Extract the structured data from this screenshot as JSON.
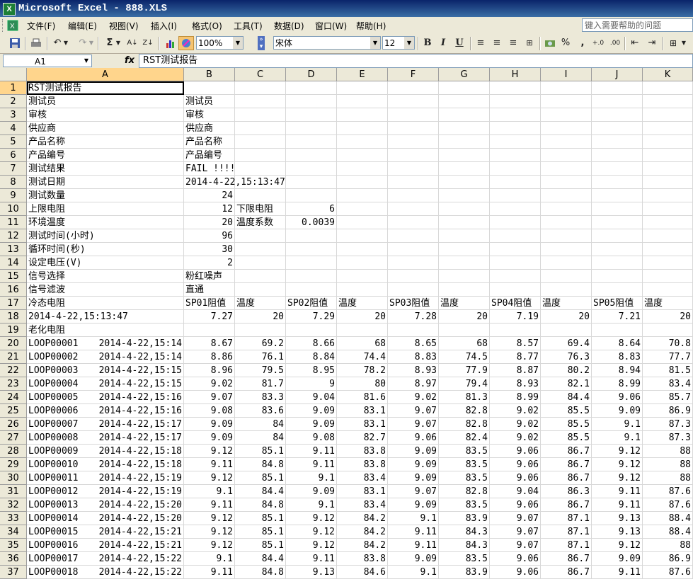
{
  "window": {
    "title": "Microsoft Excel - 888.XLS",
    "app_icon": "X"
  },
  "menu": [
    "文件(F)",
    "编辑(E)",
    "视图(V)",
    "插入(I)",
    "格式(O)",
    "工具(T)",
    "数据(D)",
    "窗口(W)",
    "帮助(H)"
  ],
  "help_placeholder": "键入需要帮助的问题",
  "toolbar": {
    "zoom": "100%",
    "font": "宋体",
    "font_size": "12",
    "bold": "B",
    "italic": "I",
    "underline": "U",
    "percent": "%",
    "comma": ","
  },
  "formula_bar": {
    "name_box": "A1",
    "fx_label": "fx",
    "content": "RST测试报告"
  },
  "column_labels": [
    "A",
    "B",
    "C",
    "D",
    "E",
    "F",
    "G",
    "H",
    "I",
    "J",
    "K"
  ],
  "row_numbers": [
    "1",
    "2",
    "3",
    "4",
    "5",
    "6",
    "7",
    "8",
    "9",
    "10",
    "11",
    "12",
    "13",
    "14",
    "15",
    "16",
    "17",
    "18",
    "19",
    "20",
    "21",
    "22",
    "23",
    "24",
    "25",
    "26",
    "27",
    "28",
    "29",
    "30",
    "31",
    "32",
    "33",
    "34",
    "35",
    "36",
    "37"
  ],
  "sheet": {
    "header_rows": [
      [
        "RST测试报告"
      ],
      [
        "测试员",
        "测试员"
      ],
      [
        "审核",
        "审核"
      ],
      [
        "供应商",
        "供应商"
      ],
      [
        "产品名称",
        "产品名称"
      ],
      [
        "产品编号",
        "产品编号"
      ],
      [
        "测试结果",
        "FAIL  !!!!"
      ],
      [
        "测试日期",
        "2014-4-22,15:13:47"
      ],
      [
        "测试数量",
        "24"
      ],
      [
        "上限电阻",
        "12",
        "下限电阻",
        "6"
      ],
      [
        "环境温度",
        "20",
        "温度系数",
        "0.0039"
      ],
      [
        "测试时间(小时)",
        "96"
      ],
      [
        "循环时间(秒)",
        "30"
      ],
      [
        "设定电压(V)",
        "2"
      ],
      [
        "信号选择",
        "粉红噪声"
      ],
      [
        "信号滤波",
        "直通"
      ],
      [
        "冷态电阻",
        "SP01阻值",
        "温度",
        "SP02阻值",
        "温度",
        "SP03阻值",
        "温度",
        "SP04阻值",
        "温度",
        "SP05阻值",
        "温度"
      ],
      [
        "2014-4-22,15:13:47",
        "7.27",
        "20",
        "7.29",
        "20",
        "7.28",
        "20",
        "7.19",
        "20",
        "7.21",
        "20"
      ],
      [
        "老化电阻"
      ]
    ],
    "loop_rows": [
      [
        "LOOP00001",
        "2014-4-22,15:14",
        "8.67",
        "69.2",
        "8.66",
        "68",
        "8.65",
        "68",
        "8.57",
        "69.4",
        "8.64",
        "70.8"
      ],
      [
        "LOOP00002",
        "2014-4-22,15:14",
        "8.86",
        "76.1",
        "8.84",
        "74.4",
        "8.83",
        "74.5",
        "8.77",
        "76.3",
        "8.83",
        "77.7"
      ],
      [
        "LOOP00003",
        "2014-4-22,15:15",
        "8.96",
        "79.5",
        "8.95",
        "78.2",
        "8.93",
        "77.9",
        "8.87",
        "80.2",
        "8.94",
        "81.5"
      ],
      [
        "LOOP00004",
        "2014-4-22,15:15",
        "9.02",
        "81.7",
        "9",
        "80",
        "8.97",
        "79.4",
        "8.93",
        "82.1",
        "8.99",
        "83.4"
      ],
      [
        "LOOP00005",
        "2014-4-22,15:16",
        "9.07",
        "83.3",
        "9.04",
        "81.6",
        "9.02",
        "81.3",
        "8.99",
        "84.4",
        "9.06",
        "85.7"
      ],
      [
        "LOOP00006",
        "2014-4-22,15:16",
        "9.08",
        "83.6",
        "9.09",
        "83.1",
        "9.07",
        "82.8",
        "9.02",
        "85.5",
        "9.09",
        "86.9"
      ],
      [
        "LOOP00007",
        "2014-4-22,15:17",
        "9.09",
        "84",
        "9.09",
        "83.1",
        "9.07",
        "82.8",
        "9.02",
        "85.5",
        "9.1",
        "87.3"
      ],
      [
        "LOOP00008",
        "2014-4-22,15:17",
        "9.09",
        "84",
        "9.08",
        "82.7",
        "9.06",
        "82.4",
        "9.02",
        "85.5",
        "9.1",
        "87.3"
      ],
      [
        "LOOP00009",
        "2014-4-22,15:18",
        "9.12",
        "85.1",
        "9.11",
        "83.8",
        "9.09",
        "83.5",
        "9.06",
        "86.7",
        "9.12",
        "88"
      ],
      [
        "LOOP00010",
        "2014-4-22,15:18",
        "9.11",
        "84.8",
        "9.11",
        "83.8",
        "9.09",
        "83.5",
        "9.06",
        "86.7",
        "9.12",
        "88"
      ],
      [
        "LOOP00011",
        "2014-4-22,15:19",
        "9.12",
        "85.1",
        "9.1",
        "83.4",
        "9.09",
        "83.5",
        "9.06",
        "86.7",
        "9.12",
        "88"
      ],
      [
        "LOOP00012",
        "2014-4-22,15:19",
        "9.1",
        "84.4",
        "9.09",
        "83.1",
        "9.07",
        "82.8",
        "9.04",
        "86.3",
        "9.11",
        "87.6"
      ],
      [
        "LOOP00013",
        "2014-4-22,15:20",
        "9.11",
        "84.8",
        "9.1",
        "83.4",
        "9.09",
        "83.5",
        "9.06",
        "86.7",
        "9.11",
        "87.6"
      ],
      [
        "LOOP00014",
        "2014-4-22,15:20",
        "9.12",
        "85.1",
        "9.12",
        "84.2",
        "9.1",
        "83.9",
        "9.07",
        "87.1",
        "9.13",
        "88.4"
      ],
      [
        "LOOP00015",
        "2014-4-22,15:21",
        "9.12",
        "85.1",
        "9.12",
        "84.2",
        "9.11",
        "84.3",
        "9.07",
        "87.1",
        "9.13",
        "88.4"
      ],
      [
        "LOOP00016",
        "2014-4-22,15:21",
        "9.12",
        "85.1",
        "9.12",
        "84.2",
        "9.11",
        "84.3",
        "9.07",
        "87.1",
        "9.12",
        "88"
      ],
      [
        "LOOP00017",
        "2014-4-22,15:22",
        "9.1",
        "84.4",
        "9.11",
        "83.8",
        "9.09",
        "83.5",
        "9.06",
        "86.7",
        "9.09",
        "86.9"
      ],
      [
        "LOOP00018",
        "2014-4-22,15:22",
        "9.11",
        "84.8",
        "9.13",
        "84.6",
        "9.1",
        "83.9",
        "9.06",
        "86.7",
        "9.11",
        "87.6"
      ]
    ]
  }
}
